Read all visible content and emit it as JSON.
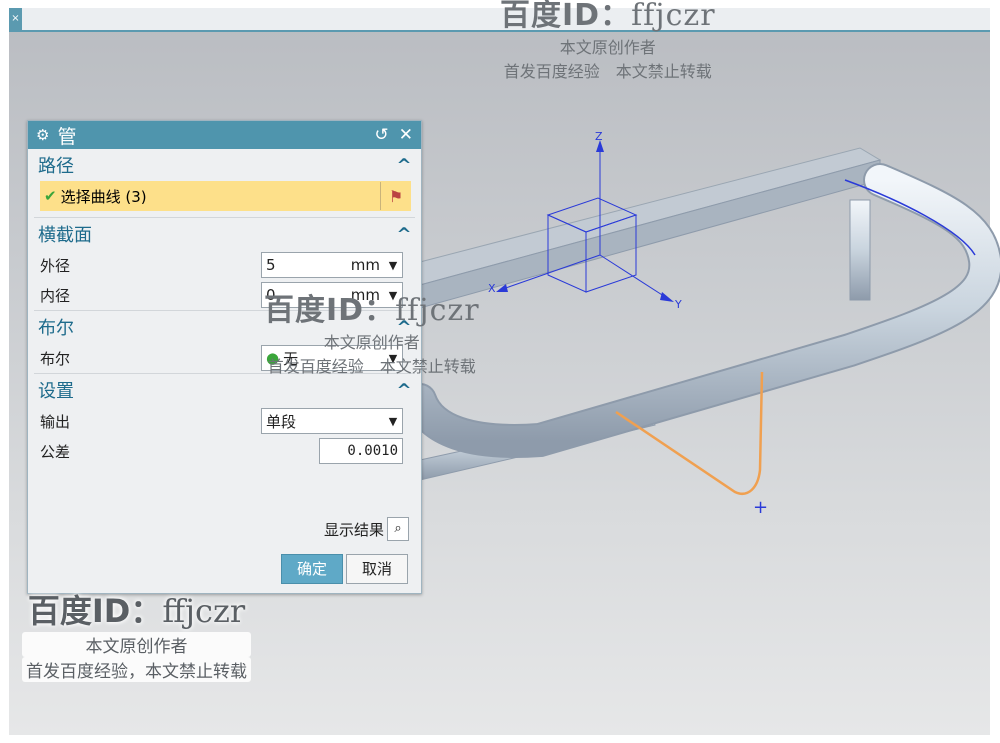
{
  "dialog": {
    "title": "管",
    "gear_icon": "⚙",
    "reset_icon": "↺",
    "close_icon": "✕",
    "sections": {
      "path": {
        "title": "路径",
        "select_curve": "选择曲线 (3)"
      },
      "cross_section": {
        "title": "横截面",
        "outer_label": "外径",
        "outer_value": "5",
        "outer_unit": "mm",
        "inner_label": "内径",
        "inner_value": "0",
        "inner_unit": "mm"
      },
      "boolean": {
        "title": "布尔",
        "label": "布尔",
        "value": "无"
      },
      "settings": {
        "title": "设置",
        "output_label": "输出",
        "output_value": "单段",
        "tolerance_label": "公差",
        "tolerance_value": "0.0010"
      }
    },
    "show_result": "显示结果",
    "ok": "确定",
    "cancel": "取消"
  },
  "axes": {
    "x": "X",
    "y": "Y",
    "z": "Z"
  },
  "watermark": {
    "line1": "百度ID：",
    "id": "ffjczr",
    "line2": "本文原创作者",
    "line3": "首发百度经验　本文禁止转载",
    "line3_bottom": "首发百度经验，本文禁止转载"
  },
  "colors": {
    "title_bar": "#4f95ad",
    "section_title": "#1e6b8c",
    "selection": "#fde08a",
    "curve": "#f0a050"
  }
}
